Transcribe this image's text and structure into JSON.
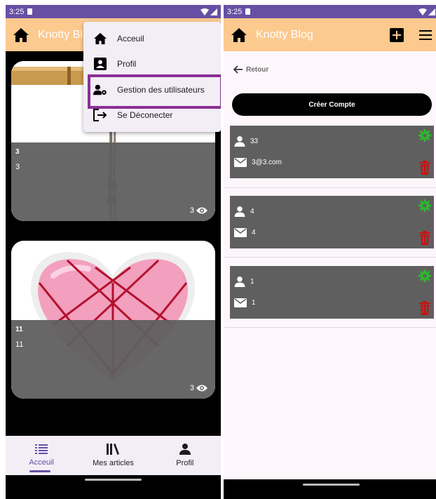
{
  "status": {
    "time": "3:25"
  },
  "app": {
    "title": "Knotty Blog"
  },
  "menu": {
    "items": [
      {
        "label": "Acceuil",
        "icon": "home-icon"
      },
      {
        "label": "Profil",
        "icon": "profile-icon"
      },
      {
        "label": "Gestion des utilisateurs",
        "icon": "manage-users-icon"
      },
      {
        "label": "Se Déconecter",
        "icon": "logout-icon"
      }
    ],
    "highlighted_item": "Gestion des utilisateurs",
    "highlight_color": "#8b2f96"
  },
  "feed": {
    "posts": [
      {
        "title": "3",
        "subtitle": "3",
        "views": "3"
      },
      {
        "title": "11",
        "subtitle": "11",
        "views": "3"
      }
    ]
  },
  "bottom_nav": {
    "items": [
      {
        "label": "Acceuil",
        "icon": "list-icon",
        "active": true
      },
      {
        "label": "Mes articles",
        "icon": "library-icon",
        "active": false
      },
      {
        "label": "Profil",
        "icon": "person-icon",
        "active": false
      }
    ]
  },
  "users_page": {
    "back_label": "Retour",
    "create_button": "Créer Compte",
    "users": [
      {
        "name": "33",
        "email": "3@3.com"
      },
      {
        "name": "4",
        "email": "4"
      },
      {
        "name": "1",
        "email": "1"
      }
    ]
  },
  "colors": {
    "status_bar": "#6750a4",
    "app_bar": "#fcc98f",
    "card_overlay": "#5f5f5f",
    "gear": "#2db82d",
    "trash": "#cc1111",
    "accent": "#6750a4"
  }
}
